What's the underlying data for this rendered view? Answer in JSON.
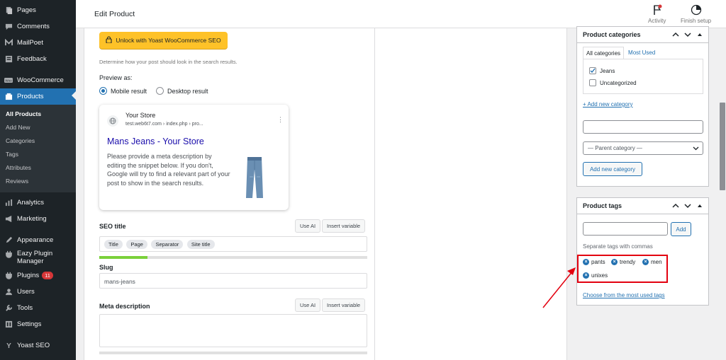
{
  "sidebar": {
    "top_items": [
      {
        "label": "Pages",
        "icon": "pages-icon"
      },
      {
        "label": "Comments",
        "icon": "comments-icon"
      },
      {
        "label": "MailPoet",
        "icon": "mailpoet-icon"
      },
      {
        "label": "Feedback",
        "icon": "feedback-icon"
      },
      {
        "label": "WooCommerce",
        "icon": "woocommerce-icon"
      },
      {
        "label": "Products",
        "icon": "products-icon"
      }
    ],
    "products_submenu": [
      "All Products",
      "Add New",
      "Categories",
      "Tags",
      "Attributes",
      "Reviews"
    ],
    "bottom_items": [
      {
        "label": "Analytics",
        "icon": "analytics-icon"
      },
      {
        "label": "Marketing",
        "icon": "marketing-icon"
      },
      {
        "label": "Appearance",
        "icon": "appearance-icon"
      },
      {
        "label": "Eazy Plugin Manager",
        "icon": "plugin-manager-icon"
      },
      {
        "label": "Plugins",
        "icon": "plugins-icon",
        "count": "11"
      },
      {
        "label": "Users",
        "icon": "users-icon"
      },
      {
        "label": "Tools",
        "icon": "tools-icon"
      },
      {
        "label": "Settings",
        "icon": "settings-icon"
      },
      {
        "label": "Yoast SEO",
        "icon": "yoast-icon"
      }
    ]
  },
  "header": {
    "title": "Edit Product",
    "activity_label": "Activity",
    "finish_setup_label": "Finish setup"
  },
  "yoast": {
    "unlock_label": "Unlock with Yoast WooCommerce SEO",
    "help_text": "Determine how your post should look in the search results.",
    "preview_as_label": "Preview as:",
    "mobile_result_label": "Mobile result",
    "desktop_result_label": "Desktop result",
    "serp": {
      "site_name": "Your Store",
      "url": "test.web6t7.com › index.php › pro...",
      "title": "Mans Jeans - Your Store",
      "description": "Please provide a meta description by editing the snippet below. If you don't, Google will try to find a relevant part of your post to show in the search results."
    },
    "seo_title_label": "SEO title",
    "use_ai_label": "Use AI",
    "insert_variable_label": "Insert variable",
    "seo_title_pills": [
      "Title",
      "Page",
      "Separator",
      "Site title"
    ],
    "seo_title_progress": 0.18,
    "slug_label": "Slug",
    "slug_value": "mans-jeans",
    "meta_description_label": "Meta description"
  },
  "categories_box": {
    "title": "Product categories",
    "tab_all": "All categories",
    "tab_most_used": "Most Used",
    "items": [
      {
        "label": "Jeans",
        "checked": true
      },
      {
        "label": "Uncategorized",
        "checked": false
      }
    ],
    "add_new_link": "+ Add new category",
    "parent_placeholder": "— Parent category —",
    "add_button": "Add new category"
  },
  "tags_box": {
    "title": "Product tags",
    "add_button": "Add",
    "hint": "Separate tags with commas",
    "tags": [
      "pants",
      "trendy",
      "men",
      "unixes"
    ],
    "choose_link": "Choose from the most used tags"
  },
  "colors": {
    "accent": "#2271b1",
    "annotation": "#e3000f",
    "yoast_yellow": "#fec228"
  }
}
